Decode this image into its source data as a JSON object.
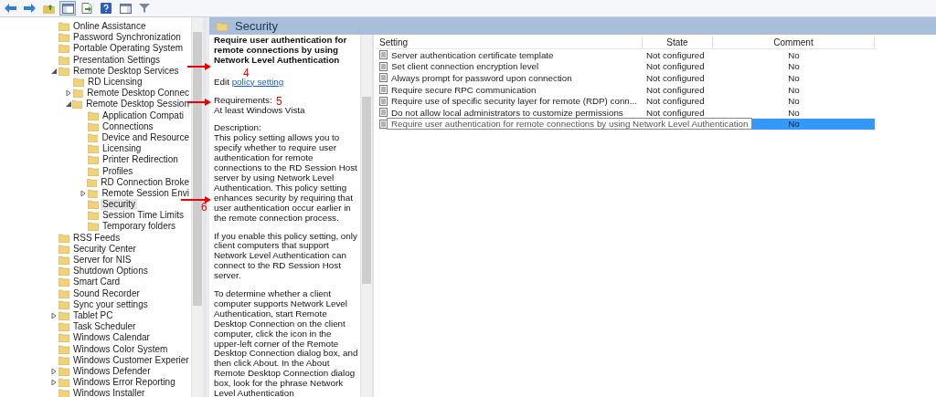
{
  "toolbar": {
    "buttons": [
      {
        "kind": "back",
        "selected": false
      },
      {
        "kind": "forward",
        "selected": false
      },
      {
        "kind": "up",
        "selected": false
      },
      {
        "kind": "tree",
        "selected": true
      },
      {
        "kind": "export",
        "selected": false
      },
      {
        "kind": "help",
        "selected": false
      },
      {
        "kind": "panel",
        "selected": false
      },
      {
        "kind": "filter",
        "selected": false
      }
    ]
  },
  "tree": [
    {
      "label": "Online Assistance",
      "selected": false
    },
    {
      "label": "Password Synchronization",
      "selected": false
    },
    {
      "label": "Portable Operating System",
      "selected": false
    },
    {
      "label": "Presentation Settings",
      "selected": false
    },
    {
      "label": "Remote Desktop Services",
      "selected": false,
      "expanded": true,
      "children": [
        {
          "label": "RD Licensing",
          "selected": false
        },
        {
          "label": "Remote Desktop Connec",
          "selected": false,
          "expanded": false
        },
        {
          "label": "Remote Desktop Session",
          "selected": false,
          "expanded": true,
          "children": [
            {
              "label": "Application Compati",
              "selected": false
            },
            {
              "label": "Connections",
              "selected": false
            },
            {
              "label": "Device and Resource",
              "selected": false
            },
            {
              "label": "Licensing",
              "selected": false
            },
            {
              "label": "Printer Redirection",
              "selected": false
            },
            {
              "label": "Profiles",
              "selected": false
            },
            {
              "label": "RD Connection Broke",
              "selected": false
            },
            {
              "label": "Remote Session Envi",
              "selected": false,
              "expanded": false
            },
            {
              "label": "Security",
              "selected": true
            },
            {
              "label": "Session Time Limits",
              "selected": false
            },
            {
              "label": "Temporary folders",
              "selected": false
            }
          ]
        }
      ]
    },
    {
      "label": "RSS Feeds",
      "selected": false
    },
    {
      "label": "Security Center",
      "selected": false
    },
    {
      "label": "Server for NIS",
      "selected": false
    },
    {
      "label": "Shutdown Options",
      "selected": false
    },
    {
      "label": "Smart Card",
      "selected": false
    },
    {
      "label": "Sound Recorder",
      "selected": false
    },
    {
      "label": "Sync your settings",
      "selected": false
    },
    {
      "label": "Tablet PC",
      "selected": false,
      "expanded": false
    },
    {
      "label": "Task Scheduler",
      "selected": false
    },
    {
      "label": "Windows Calendar",
      "selected": false
    },
    {
      "label": "Windows Color System",
      "selected": false
    },
    {
      "label": "Windows Customer Experier",
      "selected": false
    },
    {
      "label": "Windows Defender",
      "selected": false,
      "expanded": false
    },
    {
      "label": "Windows Error Reporting",
      "selected": false,
      "expanded": false
    },
    {
      "label": "Windows Installer",
      "selected": false
    }
  ],
  "header": {
    "title": "Security"
  },
  "description": {
    "title": "Require user authentication for remote connections by using Network Level Authentication",
    "edit_prefix": "Edit",
    "edit_link": "policy setting",
    "requirements_label": "Requirements:",
    "requirements": "At least Windows Vista",
    "description_label": "Description:",
    "paragraphs": [
      "This policy setting allows you to specify whether to require user authentication for remote connections to the RD Session Host server by using Network Level Authentication. This policy setting enhances security by requiring that user authentication occur earlier in the remote connection process.",
      "If you enable this policy setting, only client computers that support Network Level Authentication can connect to the RD Session Host server.",
      "To determine whether a client computer supports Network Level Authentication, start Remote Desktop Connection on the client computer, click the icon in the upper-left corner of the Remote Desktop Connection dialog box, and then click About. In the About Remote Desktop Connection dialog box, look for the phrase Network Level Authentication"
    ]
  },
  "table": {
    "columns": [
      "Setting",
      "State",
      "Comment"
    ],
    "rows": [
      {
        "setting": "Server authentication certificate template",
        "state": "Not configured",
        "comment": "No",
        "selected": false
      },
      {
        "setting": "Set client connection encryption level",
        "state": "Not configured",
        "comment": "No",
        "selected": false
      },
      {
        "setting": "Always prompt for password upon connection",
        "state": "Not configured",
        "comment": "No",
        "selected": false
      },
      {
        "setting": "Require secure RPC communication",
        "state": "Not configured",
        "comment": "No",
        "selected": false
      },
      {
        "setting": "Require use of specific security layer for remote (RDP) conn...",
        "state": "Not configured",
        "comment": "No",
        "selected": false
      },
      {
        "setting": "Do not allow local administrators to customize permissions",
        "state": "Not configured",
        "comment": "No",
        "selected": false
      },
      {
        "tooltip": "Require user authentication for remote connections by using Network Level Authentication",
        "comment": "No",
        "selected": true
      }
    ]
  },
  "annotations": [
    {
      "label": "4"
    },
    {
      "label": "5"
    },
    {
      "label": "6"
    }
  ]
}
